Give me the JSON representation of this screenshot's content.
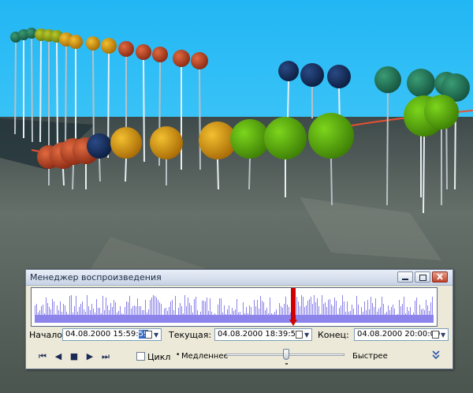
{
  "window": {
    "title": "Менеджер воспроизведения",
    "minimize_icon": "minimize-icon",
    "restore_icon": "restore-icon",
    "close_icon": "close-icon"
  },
  "timeline": {
    "playhead_position": 0.65,
    "bar_color": "#8c84ea",
    "playhead_color": "#d00000"
  },
  "fields": {
    "start_label": "Начало:",
    "start_value": "04.08.2000 15:59:",
    "start_value_selected": "59",
    "current_label": "Текущая:",
    "current_value": "04.08.2000 18:39:52",
    "end_label": "Конец:",
    "end_value": "04.08.2000 20:00:00"
  },
  "controls": {
    "first_icon": "⏮",
    "prev_icon": "◀",
    "stop_icon": "■",
    "play_icon": "▶",
    "last_icon": "⏭",
    "loop_label": "Цикл",
    "slower_label": "Медленнее",
    "faster_label": "Быстрее",
    "speed_level": 0.5,
    "expand_icon": "⌄"
  },
  "colors": {
    "sky": "#2ab8f3",
    "titlebar": "#c7d3e6"
  }
}
